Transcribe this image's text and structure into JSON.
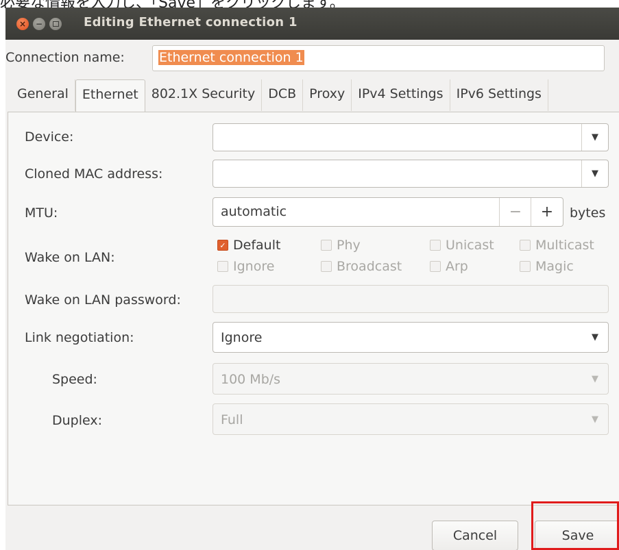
{
  "caption": "必要な情報を入力し、「Save」をクリックします。",
  "window": {
    "title": "Editing Ethernet connection 1"
  },
  "connection_name": {
    "label": "Connection name:",
    "value": "Ethernet connection 1"
  },
  "tabs": [
    {
      "label": "General"
    },
    {
      "label": "Ethernet"
    },
    {
      "label": "802.1X Security"
    },
    {
      "label": "DCB"
    },
    {
      "label": "Proxy"
    },
    {
      "label": "IPv4 Settings"
    },
    {
      "label": "IPv6 Settings"
    }
  ],
  "active_tab": "Ethernet",
  "form": {
    "device_label": "Device:",
    "device_value": "",
    "cloned_mac_label": "Cloned MAC address:",
    "cloned_mac_value": "",
    "mtu_label": "MTU:",
    "mtu_value": "automatic",
    "mtu_minus": "−",
    "mtu_plus": "+",
    "mtu_unit": "bytes",
    "wol_label": "Wake on LAN:",
    "wol_options": [
      {
        "label": "Default",
        "checked": true
      },
      {
        "label": "Phy",
        "checked": false
      },
      {
        "label": "Unicast",
        "checked": false
      },
      {
        "label": "Multicast",
        "checked": false
      },
      {
        "label": "Ignore",
        "checked": false
      },
      {
        "label": "Broadcast",
        "checked": false
      },
      {
        "label": "Arp",
        "checked": false
      },
      {
        "label": "Magic",
        "checked": false
      }
    ],
    "wol_password_label": "Wake on LAN password:",
    "wol_password_value": "",
    "link_neg_label": "Link negotiation:",
    "link_neg_value": "Ignore",
    "speed_label": "Speed:",
    "speed_value": "100 Mb/s",
    "duplex_label": "Duplex:",
    "duplex_value": "Full"
  },
  "buttons": {
    "cancel": "Cancel",
    "save": "Save"
  },
  "icons": {
    "close": "close-icon",
    "minimize": "minimize-icon",
    "maximize": "maximize-icon",
    "dropdown": "chevron-down-icon",
    "check": "checkmark-icon"
  },
  "colors": {
    "accent": "#e0602e",
    "highlight": "#e01b1b",
    "titlebar": "#3c3b37"
  }
}
